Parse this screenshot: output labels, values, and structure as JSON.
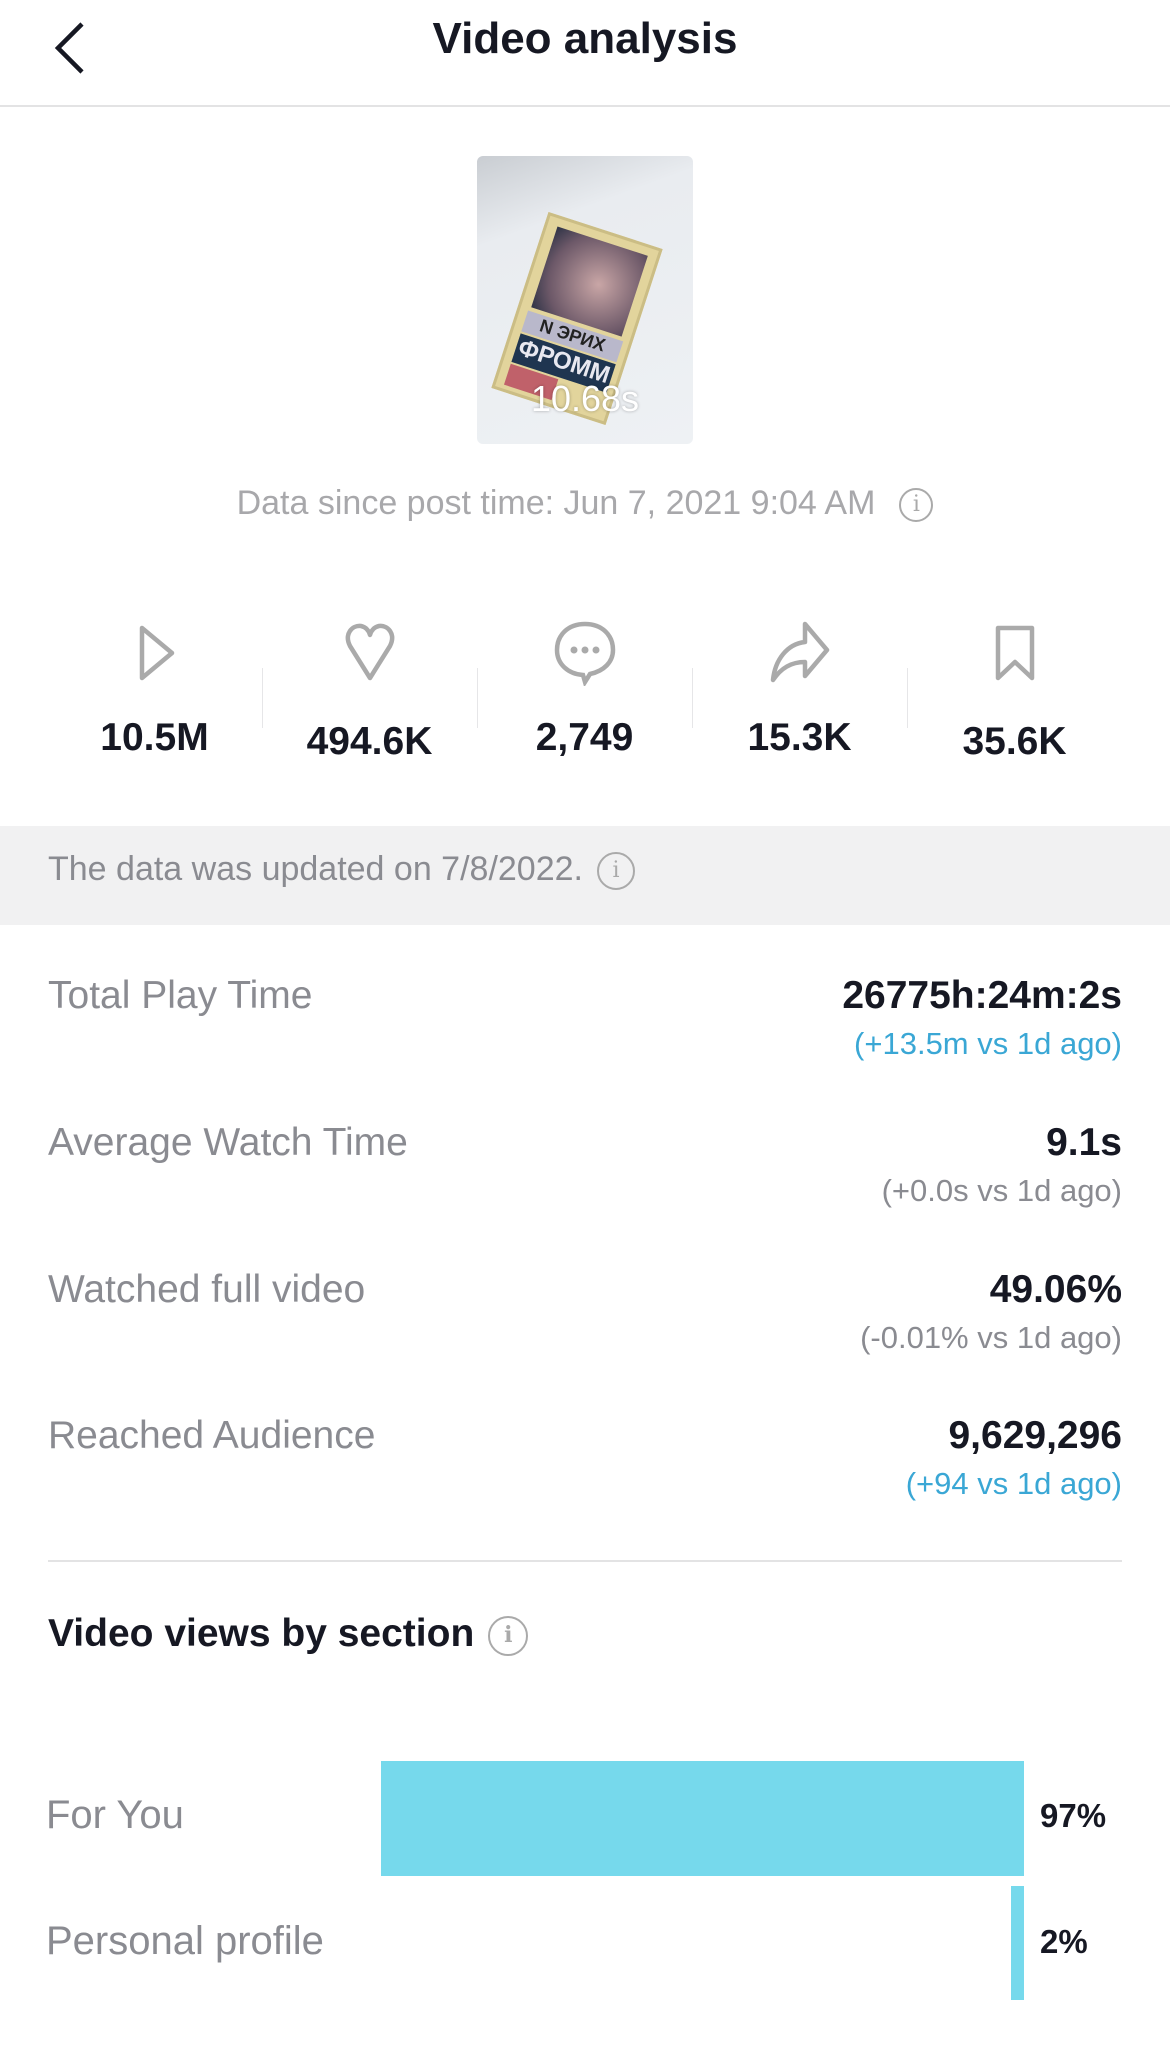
{
  "header": {
    "title": "Video analysis",
    "back_icon": "chevron-left-icon"
  },
  "video": {
    "duration": "10.68s",
    "posted": "Data since post time: Jun 7, 2021 9:04 AM"
  },
  "stats": [
    {
      "icon": "play-icon",
      "value": "10.5M"
    },
    {
      "icon": "heart-icon",
      "value": "494.6K"
    },
    {
      "icon": "comment-icon",
      "value": "2,749"
    },
    {
      "icon": "share-icon",
      "value": "15.3K"
    },
    {
      "icon": "bookmark-icon",
      "value": "35.6K"
    }
  ],
  "update_notice": "The data was updated on 7/8/2022.",
  "metrics": [
    {
      "label": "Total Play Time",
      "value": "26775h:24m:2s",
      "change": "(+13.5m vs 1d ago)",
      "positive": true
    },
    {
      "label": "Average Watch Time",
      "value": "9.1s",
      "change": "(+0.0s vs 1d ago)",
      "positive": false
    },
    {
      "label": "Watched full video",
      "value": "49.06%",
      "change": "(-0.01% vs 1d ago)",
      "positive": false
    },
    {
      "label": "Reached Audience",
      "value": "9,629,296",
      "change": "(+94 vs 1d ago)",
      "positive": true
    }
  ],
  "section": {
    "title": "Video views by section"
  },
  "chart_data": {
    "type": "bar",
    "orientation": "horizontal",
    "categories": [
      "For You",
      "Personal profile"
    ],
    "values": [
      97,
      2
    ],
    "labels": [
      "97%",
      "2%"
    ],
    "color": "#76d9ec"
  },
  "colors": {
    "positive_change": "#3aa7d5",
    "bar": "#76d9ec"
  }
}
